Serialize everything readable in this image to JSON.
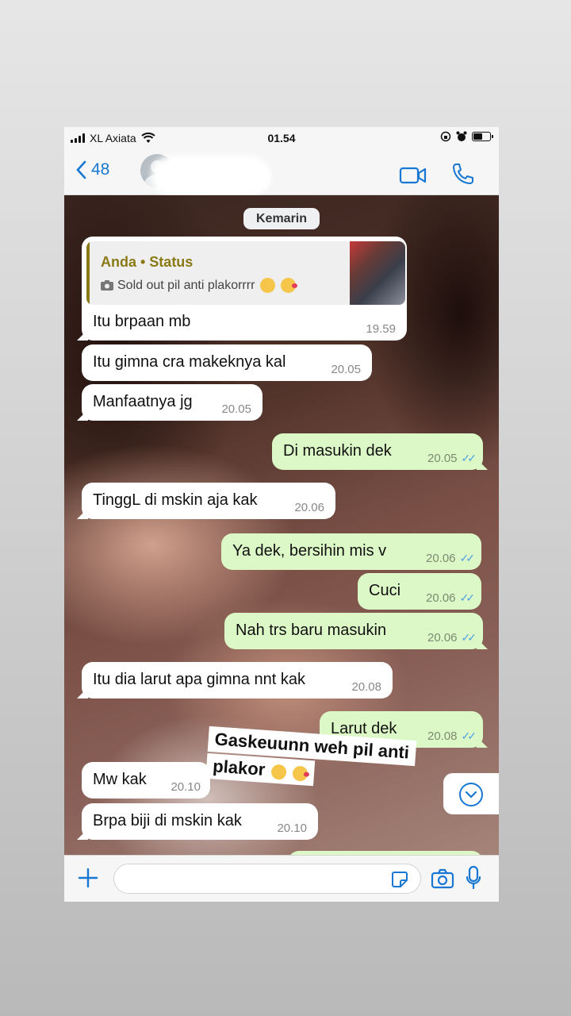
{
  "status_bar": {
    "carrier": "XL Axiata",
    "time": "01.54"
  },
  "header": {
    "back_count": "48",
    "icons": [
      "back-chevron-icon",
      "avatar",
      "video-call-icon",
      "phone-call-icon"
    ]
  },
  "chat": {
    "date_label": "Kemarin",
    "quoted_status": {
      "author": "Anda • Status",
      "text": "Sold out  pil anti plakorrrr"
    },
    "messages": [
      {
        "dir": "in",
        "text": "Itu brpaan mb",
        "time": "19.59"
      },
      {
        "dir": "in",
        "text": "Itu gimna cra makeknya kal",
        "time": "20.05"
      },
      {
        "dir": "in",
        "text": "Manfaatnya jg",
        "time": "20.05"
      },
      {
        "dir": "out",
        "text": "Di masukin dek",
        "time": "20.05"
      },
      {
        "dir": "in",
        "text": "TinggL di mskin aja kak",
        "time": "20.06"
      },
      {
        "dir": "out",
        "text": "Ya dek, bersihin mis v",
        "time": "20.06"
      },
      {
        "dir": "out",
        "text": "Cuci",
        "time": "20.06"
      },
      {
        "dir": "out",
        "text": "Nah trs baru masukin",
        "time": "20.06"
      },
      {
        "dir": "in",
        "text": "Itu dia larut apa gimna nnt kak",
        "time": "20.08"
      },
      {
        "dir": "out",
        "text": "Larut dek",
        "time": "20.08"
      },
      {
        "dir": "in",
        "text": "Mw kak",
        "time": "20.10"
      },
      {
        "dir": "in",
        "text": "Brpa biji di mskin kak",
        "time": "20.10"
      }
    ],
    "sticker_text": {
      "line1": "Gaskeuunn weh pil anti",
      "line2": "plakor"
    }
  },
  "input_bar": {
    "icons": [
      "plus-icon",
      "sticker-icon",
      "camera-icon",
      "microphone-icon"
    ]
  },
  "colors": {
    "accent": "#1877d2",
    "outgoing_bubble": "#dcf8c6",
    "incoming_bubble": "#ffffff",
    "read_ticks": "#4fa3e3",
    "quote_author": "#8a7a16"
  }
}
